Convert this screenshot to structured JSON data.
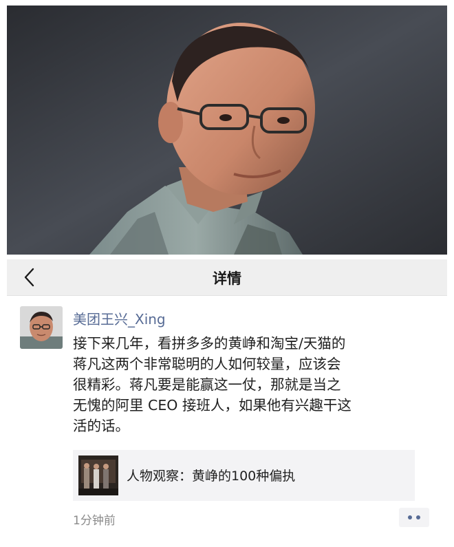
{
  "header_photo": {
    "icon": "person-photo"
  },
  "nav": {
    "title": "详情",
    "back_icon": "chevron-left-icon"
  },
  "post": {
    "author": "美团王兴_Xing",
    "text_lines": [
      "接下来几年，看拼多多的黄峥和淘宝/天猫的",
      "蒋凡这两个非常聪明的人如何较量，应该会",
      "很精彩。蒋凡要是能赢这一仗，那就是当之",
      "无愧的阿里 CEO 接班人，如果他有兴趣干这",
      "活的话。"
    ],
    "link_card": {
      "title": "人物观察：黄峥的100种偏执"
    },
    "time": "1分钟前",
    "more_icon": "more-dots-icon"
  },
  "colors": {
    "author_link": "#576b95",
    "nav_bg": "#efefef",
    "card_bg": "#f3f3f5",
    "timestamp": "#8a8a8a"
  }
}
